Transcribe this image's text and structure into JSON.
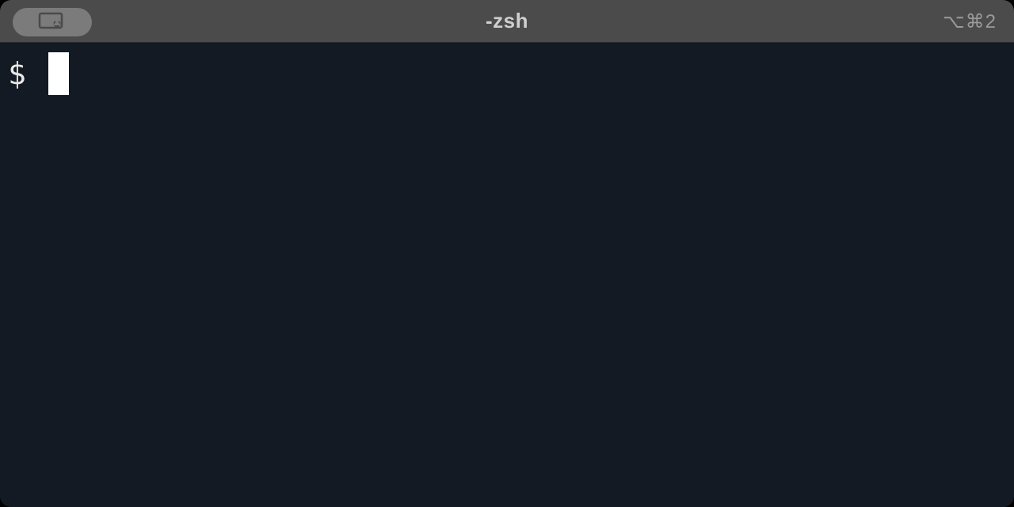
{
  "window": {
    "title": "-zsh",
    "shortcut_hint": "⌥⌘2"
  },
  "terminal": {
    "prompt": "$",
    "input_value": "",
    "cursor_visible": true
  },
  "colors": {
    "titlebar_bg": "#4b4b4b",
    "pill_bg": "#7b7b7b",
    "term_bg": "#141a23",
    "text": "#e8e8e8",
    "cursor": "#ffffff"
  }
}
